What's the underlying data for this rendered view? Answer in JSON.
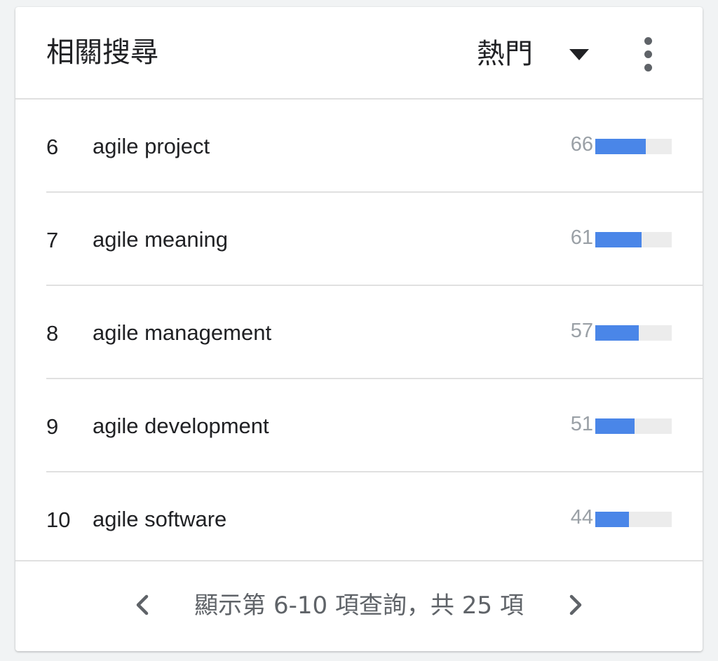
{
  "header": {
    "title": "相關搜尋",
    "sort_label": "熱門"
  },
  "icons": {
    "sort": "chevron-down-icon",
    "menu": "more-vert-icon",
    "prev": "chevron-left-icon",
    "next": "chevron-right-icon"
  },
  "colors": {
    "bar_fill": "#4a86e8",
    "bar_track": "#ececec",
    "value_text": "#9aa0a6"
  },
  "rows": [
    {
      "rank": "6",
      "query": "agile project",
      "value": "66",
      "percent": 66
    },
    {
      "rank": "7",
      "query": "agile meaning",
      "value": "61",
      "percent": 61
    },
    {
      "rank": "8",
      "query": "agile management",
      "value": "57",
      "percent": 57
    },
    {
      "rank": "9",
      "query": "agile development",
      "value": "51",
      "percent": 51
    },
    {
      "rank": "10",
      "query": "agile software",
      "value": "44",
      "percent": 44
    }
  ],
  "footer": {
    "pagination": "顯示第 6-10 項查詢，共 25 項"
  }
}
